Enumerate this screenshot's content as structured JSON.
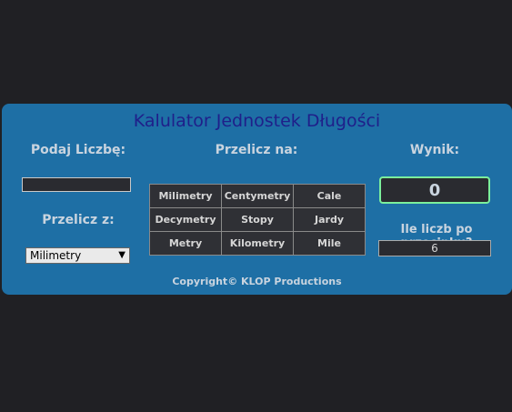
{
  "app": {
    "title": "Kalulator Jednostek Długości",
    "input_label": "Podaj Liczbę:",
    "input_value": "",
    "from_label": "Przelicz z:",
    "from_selected": "Milimetry",
    "to_label": "Przelicz na:",
    "units": [
      "Milimetry",
      "Centymetry",
      "Cale",
      "Decymetry",
      "Stopy",
      "Jardy",
      "Metry",
      "Kilometry",
      "Mile"
    ],
    "result_label": "Wynik:",
    "result_value": "0",
    "decimals_label": "Ile liczb po przecinku?",
    "decimals_value": "6",
    "copyright": "Copyright© KLOP Productions"
  }
}
